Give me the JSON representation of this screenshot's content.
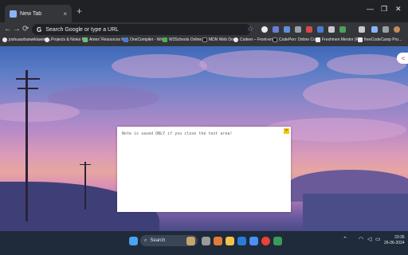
{
  "browser": {
    "tab_title": "New Tab",
    "tab_close": "×",
    "new_tab": "+",
    "window_controls": {
      "minimize": "—",
      "maximize": "❐",
      "close": "✕"
    }
  },
  "toolbar": {
    "back": "←",
    "forward": "→",
    "reload": "⟳",
    "omnibox_placeholder": "Search Google or type a URL"
  },
  "bookmarks": [
    {
      "label": "joshuaurbanwiktawina..."
    },
    {
      "label": "Projects & Notes fo..."
    },
    {
      "label": "Ames' Resources for..."
    },
    {
      "label": "OneCompiler - Writ..."
    },
    {
      "label": "W3Schools Online..."
    },
    {
      "label": "MDN Web Docs"
    },
    {
      "label": "Codeer – Front-end..."
    },
    {
      "label": "CodePen: Online Co..."
    },
    {
      "label": "Freshmen Mentor (F..."
    },
    {
      "label": "freeCodeCamp Pro..."
    }
  ],
  "extension": {
    "side_icon": "<"
  },
  "note": {
    "text": "Note is saved ONLY if you close the text area!",
    "close_label": "×"
  },
  "taskbar": {
    "search_label": "Search",
    "time": "23:35",
    "date": "26-06-2024"
  },
  "colors": {
    "accent": "#8ab4f8",
    "note_button": "#f5c518",
    "side_icon": "#d93025"
  }
}
